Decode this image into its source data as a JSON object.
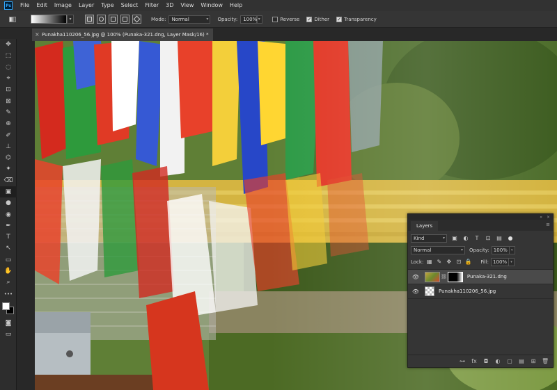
{
  "menu": {
    "logo": "Ps",
    "items": [
      "File",
      "Edit",
      "Image",
      "Layer",
      "Type",
      "Select",
      "Filter",
      "3D",
      "View",
      "Window",
      "Help"
    ]
  },
  "options": {
    "mode_label": "Mode:",
    "mode_value": "Normal",
    "opacity_label": "Opacity:",
    "opacity_value": "100%",
    "reverse_label": "Reverse",
    "reverse_checked": false,
    "dither_label": "Dither",
    "dither_checked": true,
    "transparency_label": "Transparency",
    "transparency_checked": true
  },
  "document": {
    "tab_title": "Punakha110206_56.jpg @ 100% (Punaka-321.dng, Layer Mask/16) *",
    "close_glyph": "×"
  },
  "tools": [
    "✥",
    "⬚",
    "◌",
    "⌖",
    "⊡",
    "⊠",
    "✎",
    "⊕",
    "✐",
    "⊥",
    "⌬",
    "✦",
    "⌫",
    "▣",
    "●",
    "◉",
    "✒",
    "T",
    "↖",
    "▭",
    "✋",
    "⌕",
    "•••"
  ],
  "tools_active_index": 13,
  "layers_panel": {
    "collapse_glyph": "«",
    "close_glyph": "×",
    "tab_label": "Layers",
    "menu_glyph": "≡",
    "kind_value": "Kind",
    "blend_value": "Normal",
    "opacity_label": "Opacity:",
    "opacity_value": "100%",
    "lock_label": "Lock:",
    "fill_label": "Fill:",
    "fill_value": "100%",
    "layers": [
      {
        "name": "Punaka-321.dng",
        "selected": true,
        "has_mask": true
      },
      {
        "name": "Punakha110206_56.jpg",
        "selected": false,
        "has_mask": false
      }
    ],
    "bottom_icons": [
      "⊶",
      "fx",
      "◘",
      "◐",
      "▢",
      "▤",
      "⊞",
      "🗑"
    ]
  }
}
